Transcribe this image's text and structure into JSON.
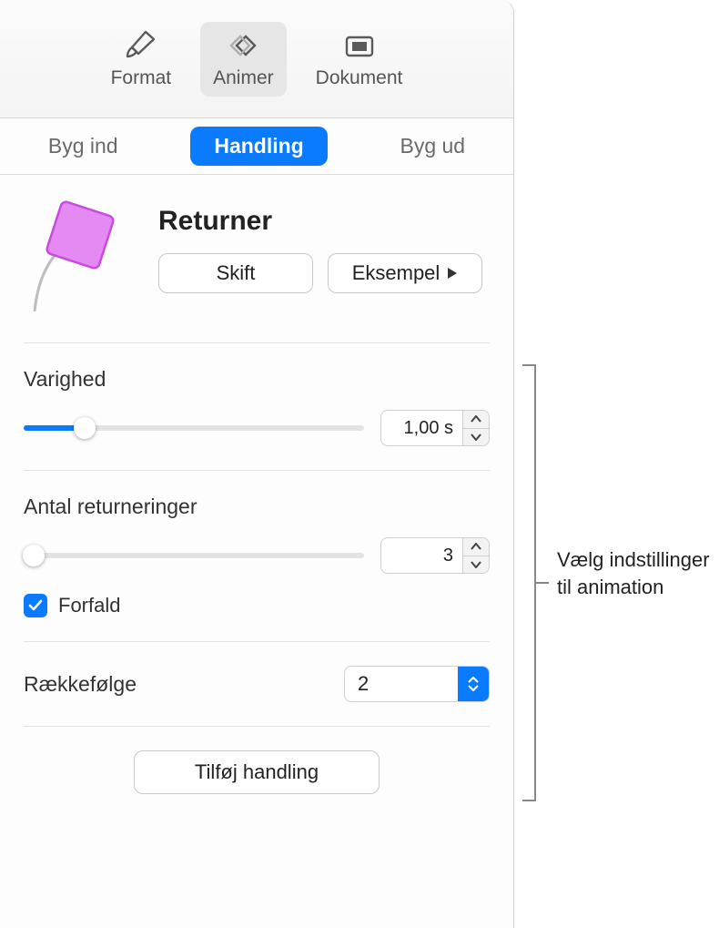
{
  "toolbar": {
    "format": "Format",
    "animate": "Animer",
    "document": "Dokument"
  },
  "tabs": {
    "build_in": "Byg ind",
    "action": "Handling",
    "build_out": "Byg ud"
  },
  "header": {
    "title": "Returner",
    "change_label": "Skift",
    "preview_label": "Eksempel"
  },
  "duration": {
    "label": "Varighed",
    "value": "1,00 s",
    "slider_percent": 18
  },
  "bounces": {
    "label": "Antal returneringer",
    "value": "3",
    "slider_percent": 3
  },
  "decay": {
    "label": "Forfald",
    "checked": true
  },
  "order": {
    "label": "Rækkefølge",
    "value": "2"
  },
  "add_action_label": "Tilføj handling",
  "callout": "Vælg indstillinger til animation"
}
